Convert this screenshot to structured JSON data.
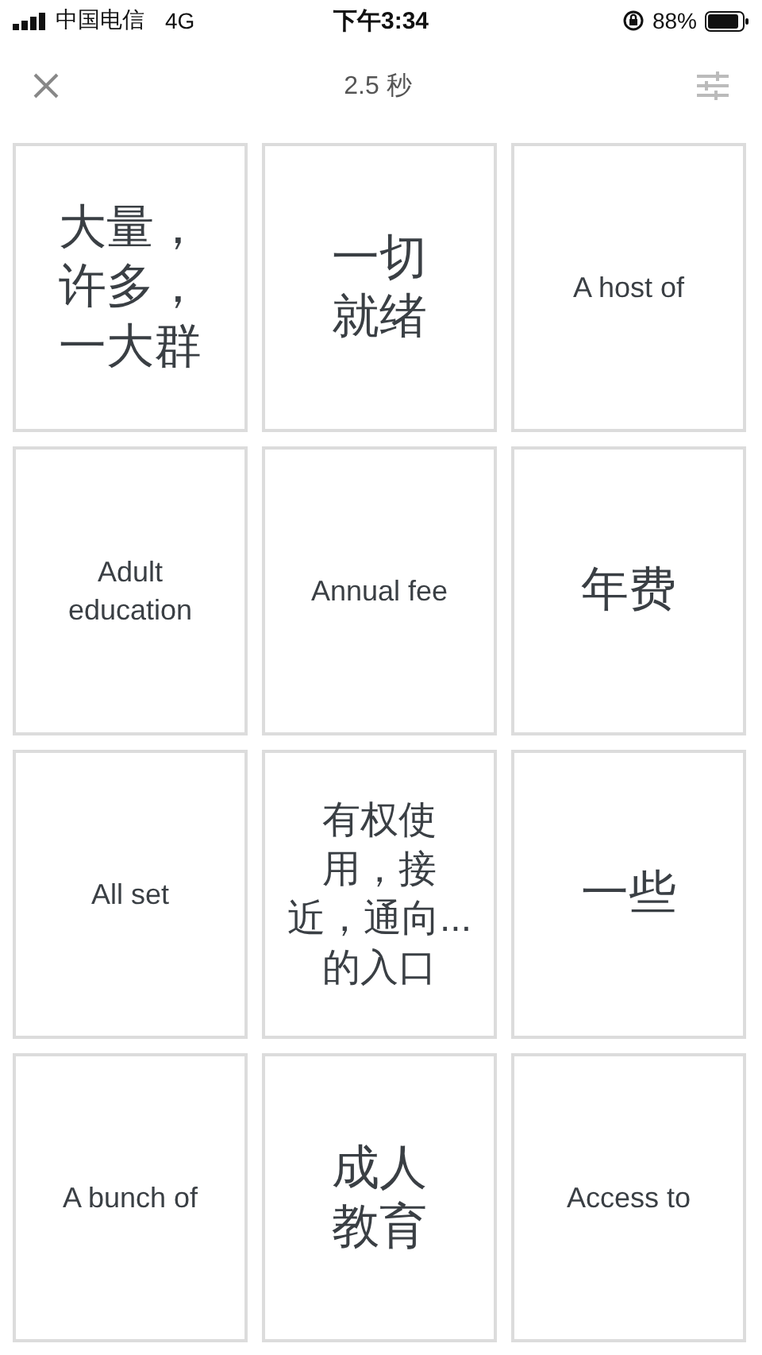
{
  "status_bar": {
    "carrier": "中国电信",
    "network": "4G",
    "time": "下午3:34",
    "battery": "88%"
  },
  "toolbar": {
    "title": "2.5 秒"
  },
  "cards": [
    {
      "kind": "chinese",
      "lines": [
        "大量，",
        "许多，",
        "一大群"
      ]
    },
    {
      "kind": "chinese",
      "lines": [
        "一切",
        "就绪"
      ]
    },
    {
      "kind": "english",
      "lines": [
        "A host of"
      ]
    },
    {
      "kind": "english",
      "lines": [
        "Adult",
        "education"
      ]
    },
    {
      "kind": "english",
      "lines": [
        "Annual fee"
      ]
    },
    {
      "kind": "chinese",
      "lines": [
        "年费"
      ]
    },
    {
      "kind": "english",
      "lines": [
        "All set"
      ]
    },
    {
      "kind": "chinese_small",
      "lines": [
        "有权使",
        "用，接",
        "近，通向...",
        "的入口"
      ]
    },
    {
      "kind": "chinese",
      "lines": [
        "一些"
      ]
    },
    {
      "kind": "english",
      "lines": [
        "A bunch of"
      ]
    },
    {
      "kind": "chinese",
      "lines": [
        "成人",
        "教育"
      ]
    },
    {
      "kind": "english",
      "lines": [
        "Access to"
      ]
    }
  ]
}
